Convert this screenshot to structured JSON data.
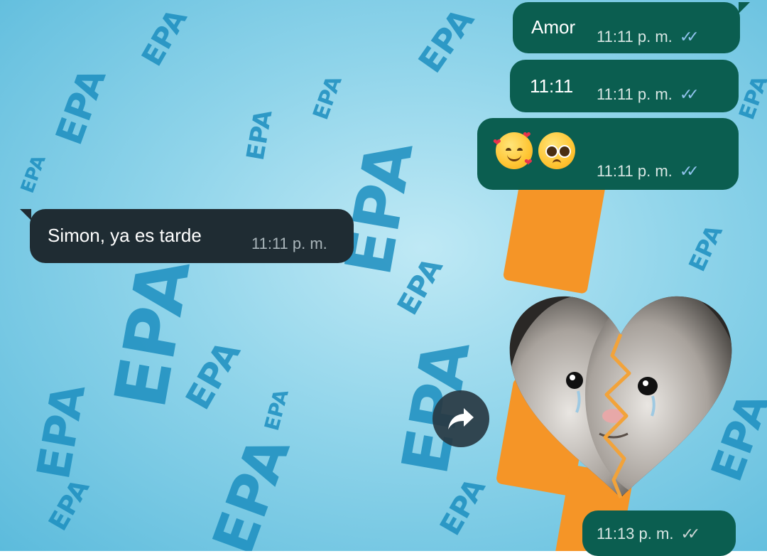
{
  "background": {
    "watermark_text": "EPA",
    "colors": {
      "base": "#8fd4ea",
      "watermark": "#1d8fc0",
      "accent": "#f59527"
    }
  },
  "messages": [
    {
      "direction": "outgoing",
      "text": "Amor",
      "time": "11:11 p. m.",
      "status": "read"
    },
    {
      "direction": "outgoing",
      "text": "11:11",
      "time": "11:11 p. m.",
      "status": "read"
    },
    {
      "direction": "outgoing",
      "emojis": [
        "smiling-face-with-hearts",
        "pleading-face"
      ],
      "time": "11:11 p. m.",
      "status": "read"
    },
    {
      "direction": "incoming",
      "text": "Simon, ya es tarde",
      "time": "11:11 p. m."
    },
    {
      "direction": "outgoing",
      "type": "sticker",
      "sticker": "crying-cat-broken-heart-sticker",
      "time": "11:13 p. m.",
      "status": "read"
    }
  ],
  "forward_button": {
    "icon": "forward-arrow-icon"
  },
  "colors": {
    "outgoing_bubble": "#0b5e50",
    "incoming_bubble": "#1f2c33",
    "read_ticks": "#8fc2ec"
  }
}
